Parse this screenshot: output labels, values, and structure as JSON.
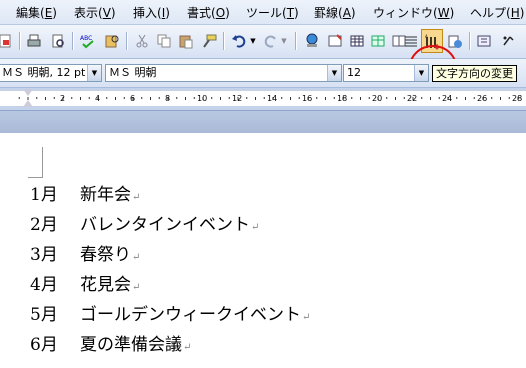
{
  "menubar": {
    "items": [
      {
        "label": "編集(",
        "acc": "E",
        "end": ")"
      },
      {
        "label": "表示(",
        "acc": "V",
        "end": ")"
      },
      {
        "label": "挿入(",
        "acc": "I",
        "end": ")"
      },
      {
        "label": "書式(",
        "acc": "O",
        "end": ")"
      },
      {
        "label": "ツール(",
        "acc": "T",
        "end": ")"
      },
      {
        "label": "罫線(",
        "acc": "A",
        "end": ")"
      },
      {
        "label": "ウィンドウ(",
        "acc": "W",
        "end": ")"
      },
      {
        "label": "ヘルプ(",
        "acc": "H",
        "end": ")"
      }
    ]
  },
  "formatting": {
    "style_value": "ＭＳ 明朝, 12 pt",
    "font_value": "ＭＳ 明朝",
    "size_value": "12"
  },
  "tooltip": "文字方向の変更",
  "ruler": {
    "labels": [
      "2",
      "4",
      "6",
      "8",
      "10",
      "12",
      "14",
      "16",
      "18",
      "20",
      "22",
      "24",
      "26",
      "28"
    ]
  },
  "document": {
    "lines": [
      {
        "month": "1月",
        "text": "新年会"
      },
      {
        "month": "2月",
        "text": "バレンタインイベント"
      },
      {
        "month": "3月",
        "text": "春祭り"
      },
      {
        "month": "4月",
        "text": "花見会"
      },
      {
        "month": "5月",
        "text": "ゴールデンウィークイベント"
      },
      {
        "month": "6月",
        "text": "夏の準備会議"
      }
    ],
    "para_mark": "↵"
  },
  "colors": {
    "highlight": "#f7d88e",
    "circle": "#e01010",
    "tooltip_bg": "#ffffe1"
  }
}
